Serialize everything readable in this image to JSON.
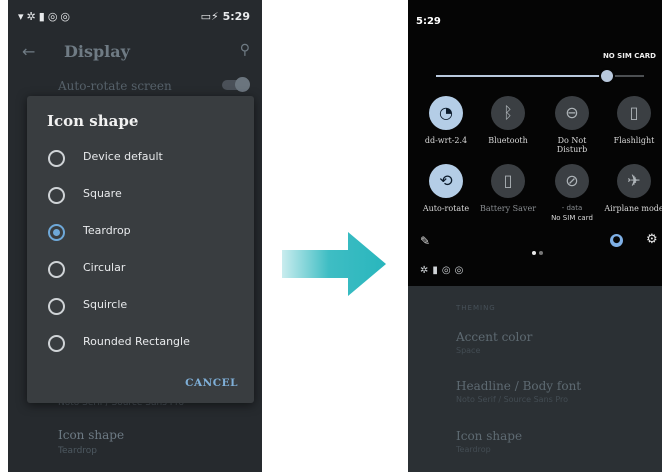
{
  "left_phone": {
    "status_bar": {
      "left_icons": "wifi-icon gear-icon battery-saver-icon data-saver-icon",
      "battery": "▭",
      "time": "5:29"
    },
    "app_bar": {
      "title": "Display"
    },
    "rows": {
      "auto_rotate": "Auto-rotate screen"
    },
    "dialog": {
      "title": "Icon shape",
      "options": [
        {
          "label": "Device default",
          "selected": false
        },
        {
          "label": "Square",
          "selected": false
        },
        {
          "label": "Teardrop",
          "selected": true
        },
        {
          "label": "Circular",
          "selected": false
        },
        {
          "label": "Squircle",
          "selected": false
        },
        {
          "label": "Rounded Rectangle",
          "selected": false
        }
      ],
      "cancel": "CANCEL"
    },
    "below": {
      "font_subtitle": "Noto Serif / Source Sans Pro",
      "icon_shape_title": "Icon shape",
      "icon_shape_value": "Teardrop"
    }
  },
  "right_phone": {
    "time": "5:29",
    "carrier": "NO SIM CARD",
    "brightness": 0.82,
    "tiles": [
      {
        "label": "dd-wrt-2.4",
        "icon": "wifi-icon",
        "active": true
      },
      {
        "label": "Bluetooth",
        "icon": "bluetooth-icon",
        "active": false
      },
      {
        "label": "Do Not Disturb",
        "icon": "do-not-disturb-icon",
        "active": false
      },
      {
        "label": "Flashlight",
        "icon": "flashlight-icon",
        "active": false
      },
      {
        "label": "Auto-rotate",
        "icon": "auto-rotate-icon",
        "active": true
      },
      {
        "label": "Battery Saver",
        "icon": "battery-icon",
        "active": false
      },
      {
        "label": "- data",
        "sublabel": "No SIM card",
        "icon": "no-sim-icon",
        "active": false
      },
      {
        "label": "Airplane mode",
        "icon": "airplane-icon",
        "active": false
      }
    ],
    "settings_below": {
      "section": "THEMING",
      "items": [
        {
          "title": "Accent color",
          "value": "Space"
        },
        {
          "title": "Headline / Body font",
          "value": "Noto Serif / Source Sans Pro"
        },
        {
          "title": "Icon shape",
          "value": "Teardrop"
        }
      ]
    }
  },
  "colors": {
    "accent": "#6ea8d8",
    "arrow": "#29b6bd",
    "tile_active": "#b4cde6"
  }
}
